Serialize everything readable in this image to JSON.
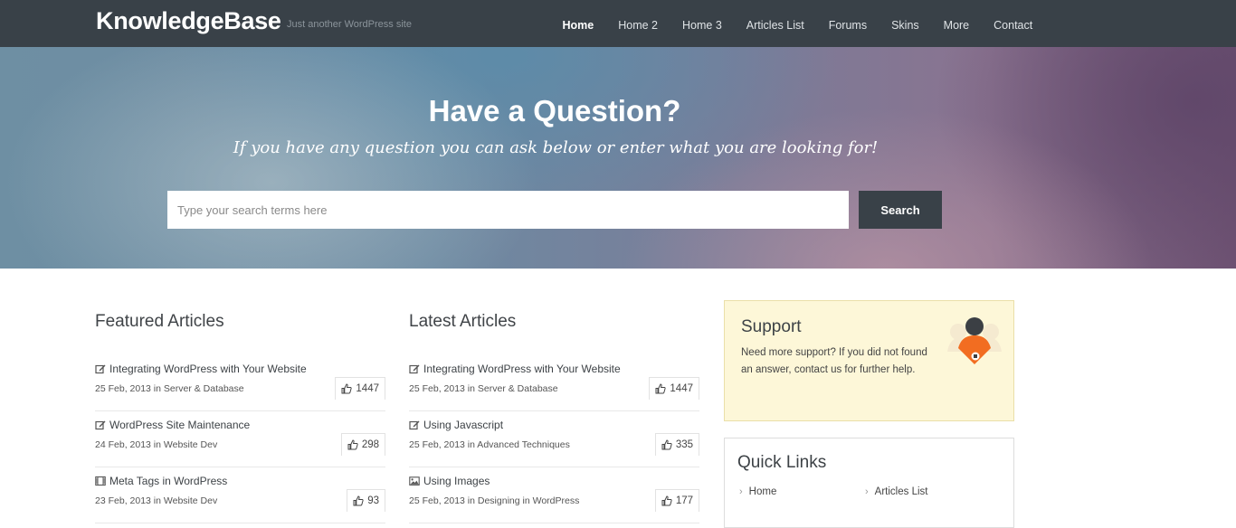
{
  "site": {
    "name": "KnowledgeBase",
    "tagline": "Just another WordPress site"
  },
  "nav": [
    "Home",
    "Home 2",
    "Home 3",
    "Articles List",
    "Forums",
    "Skins",
    "More",
    "Contact"
  ],
  "hero": {
    "title": "Have a Question?",
    "subtitle": "If you have any question you can ask below or enter what you are looking for!",
    "search_placeholder": "Type your search terms here",
    "search_button": "Search"
  },
  "featured": {
    "heading": "Featured Articles",
    "articles": [
      {
        "icon": "edit-icon",
        "title": "Integrating WordPress with Your Website",
        "meta": "25 Feb, 2013 in Server & Database",
        "likes": "1447"
      },
      {
        "icon": "edit-icon",
        "title": "WordPress Site Maintenance",
        "meta": "24 Feb, 2013 in Website Dev",
        "likes": "298"
      },
      {
        "icon": "film-icon",
        "title": "Meta Tags in WordPress",
        "meta": "23 Feb, 2013 in Website Dev",
        "likes": "93"
      }
    ]
  },
  "latest": {
    "heading": "Latest Articles",
    "articles": [
      {
        "icon": "edit-icon",
        "title": "Integrating WordPress with Your Website",
        "meta": "25 Feb, 2013 in Server & Database",
        "likes": "1447"
      },
      {
        "icon": "edit-icon",
        "title": "Using Javascript",
        "meta": "25 Feb, 2013 in Advanced Techniques",
        "likes": "335"
      },
      {
        "icon": "image-icon",
        "title": "Using Images",
        "meta": "25 Feb, 2013 in Designing in WordPress",
        "likes": "177"
      }
    ]
  },
  "support": {
    "title": "Support",
    "text": "Need more support? If you did not found an answer, contact us for further help."
  },
  "quick_links": {
    "title": "Quick Links",
    "items": [
      "Home",
      "Articles List"
    ]
  },
  "colors": {
    "header_bg": "#394148",
    "support_bg": "#fdf7d8",
    "accent_orange": "#f26d21"
  }
}
